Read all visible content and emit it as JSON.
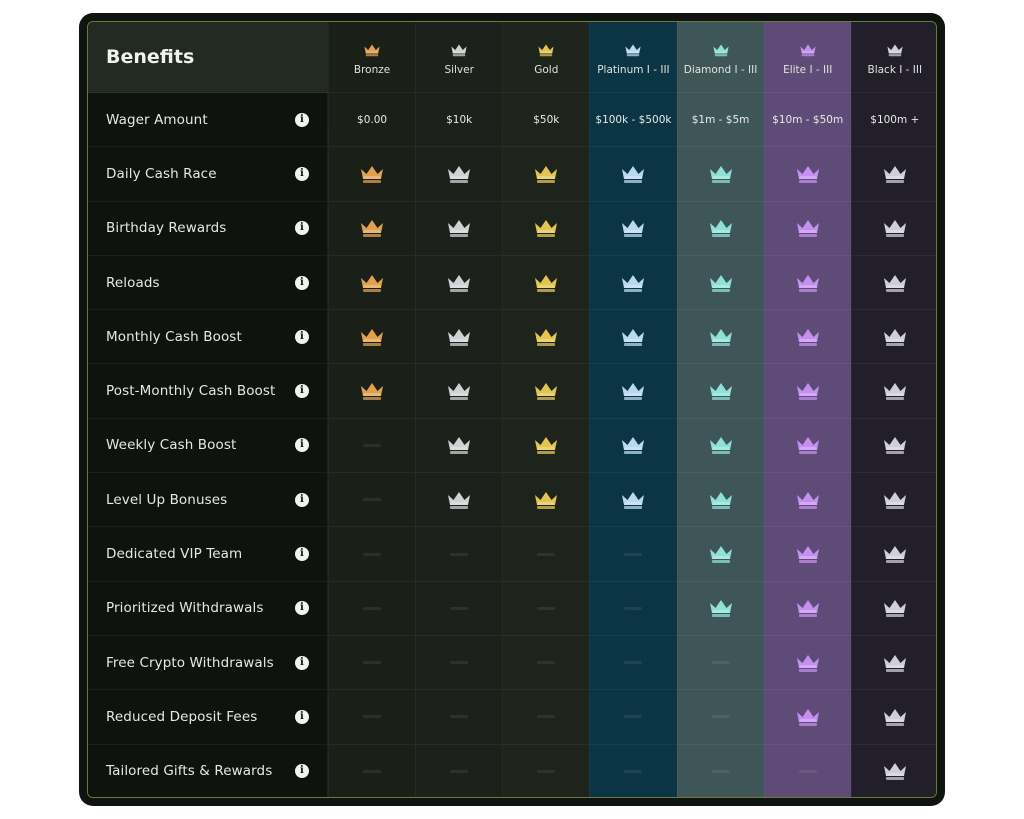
{
  "header": {
    "benefits_label": "Benefits"
  },
  "tiers": [
    {
      "name": "Bronze",
      "color": "#e0a14e",
      "bg": "#1a1f18",
      "wager": "$0.00"
    },
    {
      "name": "Silver",
      "color": "#cfd2d3",
      "bg": "#1c211b",
      "wager": "$10k"
    },
    {
      "name": "Gold",
      "color": "#e2c54f",
      "bg": "#1e231c",
      "wager": "$50k"
    },
    {
      "name": "Platinum I - III",
      "color": "#b9d9f0",
      "bg": "#0b3444",
      "wager": "$100k - $500k"
    },
    {
      "name": "Diamond I - III",
      "color": "#8fe0d6",
      "bg": "#3f5658",
      "wager": "$1m - $5m"
    },
    {
      "name": "Elite I - III",
      "color": "#c58ff0",
      "bg": "#5f4b78",
      "wager": "$10m - $50m"
    },
    {
      "name": "Black I - III",
      "color": "#cfcfd6",
      "bg": "#221f2a",
      "wager": "$100m +"
    }
  ],
  "wager_row_label": "Wager Amount",
  "benefits": [
    {
      "label": "Daily Cash Race",
      "tiers": [
        1,
        1,
        1,
        1,
        1,
        1,
        1
      ]
    },
    {
      "label": "Birthday Rewards",
      "tiers": [
        1,
        1,
        1,
        1,
        1,
        1,
        1
      ]
    },
    {
      "label": "Reloads",
      "tiers": [
        1,
        1,
        1,
        1,
        1,
        1,
        1
      ]
    },
    {
      "label": "Monthly Cash Boost",
      "tiers": [
        1,
        1,
        1,
        1,
        1,
        1,
        1
      ]
    },
    {
      "label": "Post-Monthly Cash Boost",
      "tiers": [
        1,
        1,
        1,
        1,
        1,
        1,
        1
      ]
    },
    {
      "label": "Weekly Cash Boost",
      "tiers": [
        0,
        1,
        1,
        1,
        1,
        1,
        1
      ]
    },
    {
      "label": "Level Up Bonuses",
      "tiers": [
        0,
        1,
        1,
        1,
        1,
        1,
        1
      ]
    },
    {
      "label": "Dedicated VIP Team",
      "tiers": [
        0,
        0,
        0,
        0,
        1,
        1,
        1
      ]
    },
    {
      "label": "Prioritized Withdrawals",
      "tiers": [
        0,
        0,
        0,
        0,
        1,
        1,
        1
      ]
    },
    {
      "label": "Free Crypto Withdrawals",
      "tiers": [
        0,
        0,
        0,
        0,
        0,
        1,
        1
      ]
    },
    {
      "label": "Reduced Deposit Fees",
      "tiers": [
        0,
        0,
        0,
        0,
        0,
        1,
        1
      ]
    },
    {
      "label": "Tailored Gifts & Rewards",
      "tiers": [
        0,
        0,
        0,
        0,
        0,
        0,
        1
      ]
    }
  ],
  "icons": {
    "info": "info-icon",
    "crown": "crown-icon",
    "unavailable": "dash-icon"
  }
}
